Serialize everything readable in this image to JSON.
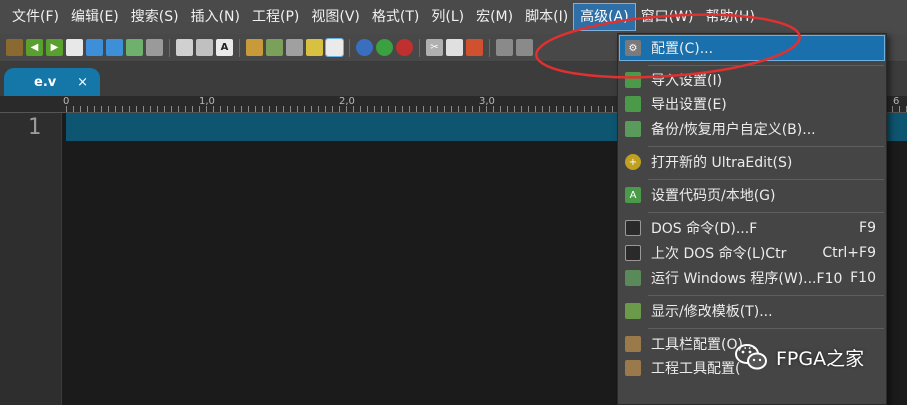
{
  "menubar": {
    "items": [
      "文件(F)",
      "编辑(E)",
      "搜索(S)",
      "插入(N)",
      "工程(P)",
      "视图(V)",
      "格式(T)",
      "列(L)",
      "宏(M)",
      "脚本(I)",
      "高级(A)",
      "窗口(W)",
      "帮助(H)"
    ],
    "active": "高级(A)"
  },
  "tab": {
    "filename": "e.v",
    "close": "×"
  },
  "ruler": {
    "labels": [
      "0",
      "1,0",
      "2,0",
      "3,0",
      "6"
    ]
  },
  "editor": {
    "line_number": "1"
  },
  "advanced_menu": {
    "items": [
      {
        "label": "配置(C)...",
        "shortcut": "",
        "icon": "gear-icon"
      },
      {
        "label": "导入设置(I)",
        "shortcut": "",
        "icon": "import-icon"
      },
      {
        "label": "导出设置(E)",
        "shortcut": "",
        "icon": "export-icon"
      },
      {
        "label": "备份/恢复用户自定义(B)...",
        "shortcut": "",
        "icon": "backup-icon"
      },
      {
        "label": "打开新的 UltraEdit(S)",
        "shortcut": "",
        "icon": "new-instance-icon"
      },
      {
        "label": "设置代码页/本地(G)",
        "shortcut": "",
        "icon": "codepage-icon"
      },
      {
        "label": "DOS 命令(D)...F",
        "shortcut": "F9",
        "icon": "dos-icon"
      },
      {
        "label": "上次 DOS 命令(L)Ctr",
        "shortcut": "Ctrl+F9",
        "icon": "dos-last-icon"
      },
      {
        "label": "运行 Windows 程序(W)...F10",
        "shortcut": "F10",
        "icon": "run-icon"
      },
      {
        "label": "显示/修改模板(T)...",
        "shortcut": "",
        "icon": "template-icon"
      },
      {
        "label": "工具栏配置(O)...",
        "shortcut": "",
        "icon": "toolbar-config-icon"
      },
      {
        "label": "工程工具配置(",
        "shortcut": "",
        "icon": "project-tool-icon"
      }
    ]
  },
  "watermark": {
    "text": "FPGA之家"
  },
  "colors": {
    "accent": "#1a6fad",
    "annotation": "#e03030",
    "tab": "#1577a8"
  }
}
